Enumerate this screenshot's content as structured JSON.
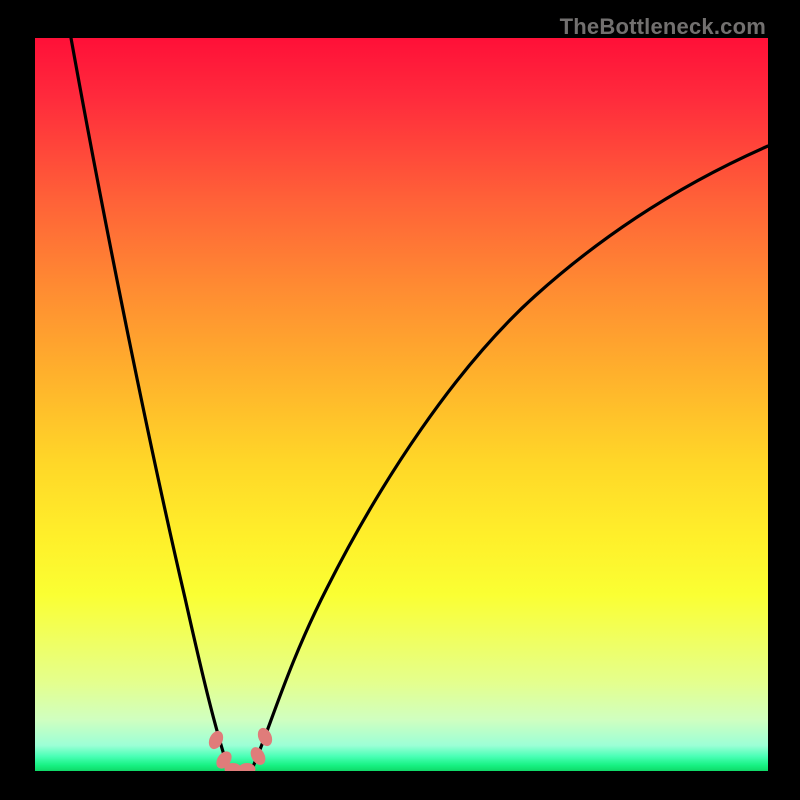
{
  "watermark": {
    "text": "TheBottleneck.com"
  },
  "chart_data": {
    "type": "line",
    "title": "",
    "xlabel": "",
    "ylabel": "",
    "xlim": [
      0,
      100
    ],
    "ylim": [
      0,
      100
    ],
    "background_gradient": {
      "top_color": "#FF1038",
      "bottom_color": "#0FD968",
      "description": "vertical red-to-green gradient, red at top (high bottleneck), green at bottom (no bottleneck)"
    },
    "series": [
      {
        "name": "left-curve",
        "x": [
          5,
          10,
          15,
          20,
          22,
          24,
          25.5,
          26.5
        ],
        "values": [
          100,
          72,
          46,
          21,
          12,
          6,
          2,
          0
        ]
      },
      {
        "name": "right-curve",
        "x": [
          29.5,
          30.5,
          33,
          38,
          45,
          55,
          65,
          75,
          85,
          95,
          100
        ],
        "values": [
          0,
          2,
          8,
          22,
          38,
          54,
          64,
          72,
          78,
          83,
          85
        ]
      },
      {
        "name": "floor",
        "x": [
          26.5,
          29.5
        ],
        "values": [
          0,
          0
        ]
      }
    ],
    "markers": [
      {
        "name": "left-lobe-upper",
        "x": 24.7,
        "y": 4.2
      },
      {
        "name": "left-lobe-lower",
        "x": 25.8,
        "y": 1.4
      },
      {
        "name": "bottom-left",
        "x": 27.0,
        "y": 0.0
      },
      {
        "name": "bottom-right",
        "x": 29.0,
        "y": 0.0
      },
      {
        "name": "right-lobe-lower",
        "x": 30.4,
        "y": 2.0
      },
      {
        "name": "right-lobe-upper",
        "x": 31.4,
        "y": 4.6
      }
    ],
    "marker_style": {
      "color": "#E07C7A",
      "rx": 6,
      "ry": 9
    }
  }
}
